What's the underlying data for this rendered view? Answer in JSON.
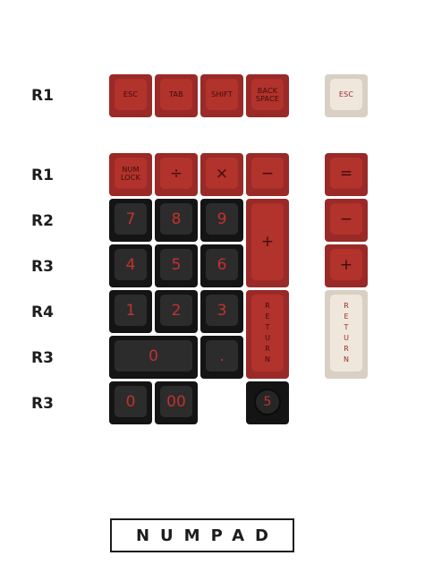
{
  "row_labels": [
    "R1",
    "R1",
    "R2",
    "R3",
    "R4",
    "R3",
    "R3"
  ],
  "top_row": {
    "esc": "ESC",
    "tab": "TAB",
    "shift": "SHIFT",
    "backspace": "BACK SPACE",
    "esc_alt": "ESC"
  },
  "numpad": {
    "numlock": "NUM LOCK",
    "divide": "÷",
    "multiply": "×",
    "minus": "−",
    "equals": "=",
    "seven": "7",
    "eight": "8",
    "nine": "9",
    "plus": "+",
    "minus_alt": "−",
    "four": "4",
    "five": "5",
    "six": "6",
    "plus_alt": "+",
    "one": "1",
    "two": "2",
    "three": "3",
    "return": "RETURN",
    "return_alt": "RETURN",
    "zero_wide": "0",
    "dot": ".",
    "zero": "0",
    "double_zero": "00",
    "knob": "5"
  },
  "title": "NUMPAD",
  "colors": {
    "red": "#b2322c",
    "black": "#141414",
    "cream": "#efe7db",
    "legend_red": "#c3322c"
  }
}
